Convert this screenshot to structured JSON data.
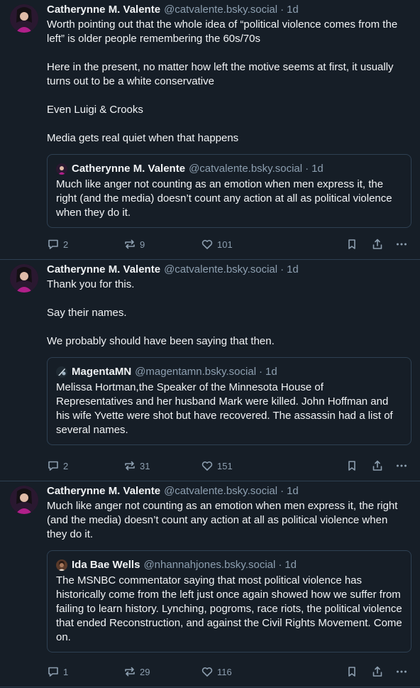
{
  "posts": [
    {
      "author": "Catherynne M. Valente",
      "handle": "@catvalente.bsky.social",
      "sep": "·",
      "time": "1d",
      "paragraphs": [
        "Worth pointing out that the whole idea of “political violence comes from the left” is older people remembering the 60s/70s",
        "Here in the present, no matter how left the motive seems at first, it usually turns out to be a white conservative",
        "Even Luigi & Crooks",
        "Media gets real quiet when that happens"
      ],
      "quote": {
        "author": "Catherynne M. Valente",
        "handle": "@catvalente.bsky.social",
        "sep": "·",
        "time": "1d",
        "text": "Much like anger not counting as an emotion when men express it, the right (and the media) doesn’t count any action at all as political violence when they do it."
      },
      "replies": "2",
      "reposts": "9",
      "likes": "101"
    },
    {
      "author": "Catherynne M. Valente",
      "handle": "@catvalente.bsky.social",
      "sep": "·",
      "time": "1d",
      "paragraphs": [
        "Thank you for this.",
        "Say their names.",
        "We probably should have been saying that then."
      ],
      "quote": {
        "author": "MagentaMN",
        "handle": "@magentamn.bsky.social",
        "sep": "·",
        "time": "1d",
        "text": "Melissa Hortman,the Speaker of the Minnesota House of Representatives and her husband Mark were killed. John Hoffman and his wife Yvette were shot but have recovered. The assassin had a list of several names."
      },
      "replies": "2",
      "reposts": "31",
      "likes": "151"
    },
    {
      "author": "Catherynne M. Valente",
      "handle": "@catvalente.bsky.social",
      "sep": "·",
      "time": "1d",
      "paragraphs": [
        "Much like anger not counting as an emotion when men express it, the right (and the media) doesn’t count any action at all as political violence when they do it."
      ],
      "quote": {
        "author": "Ida Bae Wells",
        "handle": "@nhannahjones.bsky.social",
        "sep": "·",
        "time": "1d",
        "text": "The MSNBC commentator saying that most political violence has historically come from the left just once again showed how we suffer from failing to learn history. Lynching, pogroms, race riots, the political violence that ended Reconstruction, and against the Civil Rights Movement. Come on."
      },
      "replies": "1",
      "reposts": "29",
      "likes": "116"
    }
  ],
  "icons": {
    "reply": "speech-bubble-icon",
    "repost": "repost-arrows-icon",
    "like": "heart-icon",
    "bookmark": "bookmark-icon",
    "share": "share-icon",
    "more": "more-dots-icon"
  },
  "colors": {
    "background": "#161e27",
    "border": "#2e4052",
    "text": "#f1f3f5",
    "muted": "#8d9fb0"
  }
}
